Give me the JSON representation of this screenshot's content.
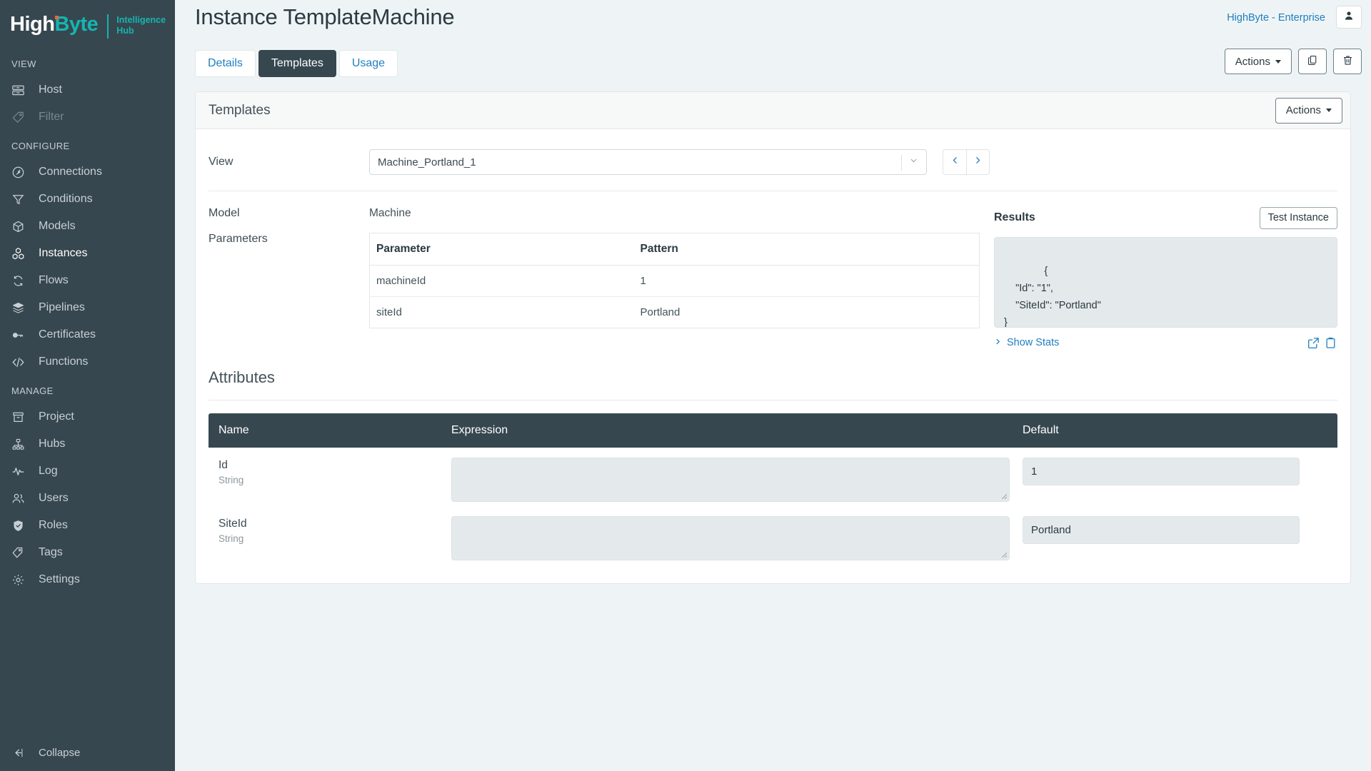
{
  "brand": {
    "name_part1": "High",
    "name_part2": "Byte",
    "subtitle_line1": "Intelligence",
    "subtitle_line2": "Hub",
    "accent_teal": "#15b5b0",
    "accent_orange": "#e8663c",
    "sidebar_bg": "#37474f",
    "page_bg": "#eef4f5",
    "link_blue": "#1f7fbf"
  },
  "sidebar": {
    "sections": [
      {
        "title": "VIEW",
        "items": [
          {
            "label": "Host",
            "icon": "server-icon",
            "state": "normal"
          },
          {
            "label": "Filter",
            "icon": "tag-icon",
            "state": "disabled"
          }
        ]
      },
      {
        "title": "CONFIGURE",
        "items": [
          {
            "label": "Connections",
            "icon": "plug-icon",
            "state": "normal"
          },
          {
            "label": "Conditions",
            "icon": "funnel-icon",
            "state": "normal"
          },
          {
            "label": "Models",
            "icon": "cube-icon",
            "state": "normal"
          },
          {
            "label": "Instances",
            "icon": "cubes-icon",
            "state": "active"
          },
          {
            "label": "Flows",
            "icon": "refresh-icon",
            "state": "normal"
          },
          {
            "label": "Pipelines",
            "icon": "layers-icon",
            "state": "normal"
          },
          {
            "label": "Certificates",
            "icon": "key-icon",
            "state": "normal"
          },
          {
            "label": "Functions",
            "icon": "code-icon",
            "state": "normal"
          }
        ]
      },
      {
        "title": "MANAGE",
        "items": [
          {
            "label": "Project",
            "icon": "archive-icon",
            "state": "normal"
          },
          {
            "label": "Hubs",
            "icon": "sitemap-icon",
            "state": "normal"
          },
          {
            "label": "Log",
            "icon": "pulse-icon",
            "state": "normal"
          },
          {
            "label": "Users",
            "icon": "users-icon",
            "state": "normal"
          },
          {
            "label": "Roles",
            "icon": "shield-check-icon",
            "state": "normal"
          },
          {
            "label": "Tags",
            "icon": "tags-icon",
            "state": "normal"
          },
          {
            "label": "Settings",
            "icon": "gear-icon",
            "state": "normal"
          }
        ]
      }
    ],
    "collapse_label": "Collapse",
    "collapse_icon": "collapse-left-icon"
  },
  "header": {
    "title": "Instance TemplateMachine",
    "enterprise_link": "HighByte - Enterprise",
    "avatar_icon": "user-icon",
    "tabs": [
      {
        "label": "Details",
        "active": false
      },
      {
        "label": "Templates",
        "active": true
      },
      {
        "label": "Usage",
        "active": false
      }
    ],
    "actions_label": "Actions",
    "copy_icon": "copy-icon",
    "delete_icon": "trash-icon"
  },
  "panel": {
    "title": "Templates",
    "actions_label": "Actions",
    "view": {
      "label": "View",
      "selected": "Machine_Portland_1",
      "prev_icon": "chevron-left-icon",
      "next_icon": "chevron-right-icon",
      "dropdown_icon": "chevron-down-icon"
    },
    "model": {
      "label": "Model",
      "value": "Machine"
    },
    "parameters": {
      "label": "Parameters",
      "columns": [
        "Parameter",
        "Pattern"
      ],
      "rows": [
        {
          "parameter": "machineId",
          "pattern": "1"
        },
        {
          "parameter": "siteId",
          "pattern": "Portland"
        }
      ]
    },
    "results": {
      "title": "Results",
      "test_button": "Test Instance",
      "json": "{\n    \"Id\": \"1\",\n    \"SiteId\": \"Portland\"\n}",
      "show_stats": "Show Stats",
      "show_stats_icon": "chevron-right-icon",
      "open_external_icon": "external-link-icon",
      "clipboard_icon": "clipboard-icon"
    },
    "attributes": {
      "title": "Attributes",
      "columns": [
        "Name",
        "Expression",
        "Default"
      ],
      "rows": [
        {
          "name": "Id",
          "type": "String",
          "expression": "",
          "default": "1"
        },
        {
          "name": "SiteId",
          "type": "String",
          "expression": "",
          "default": "Portland"
        }
      ]
    }
  }
}
